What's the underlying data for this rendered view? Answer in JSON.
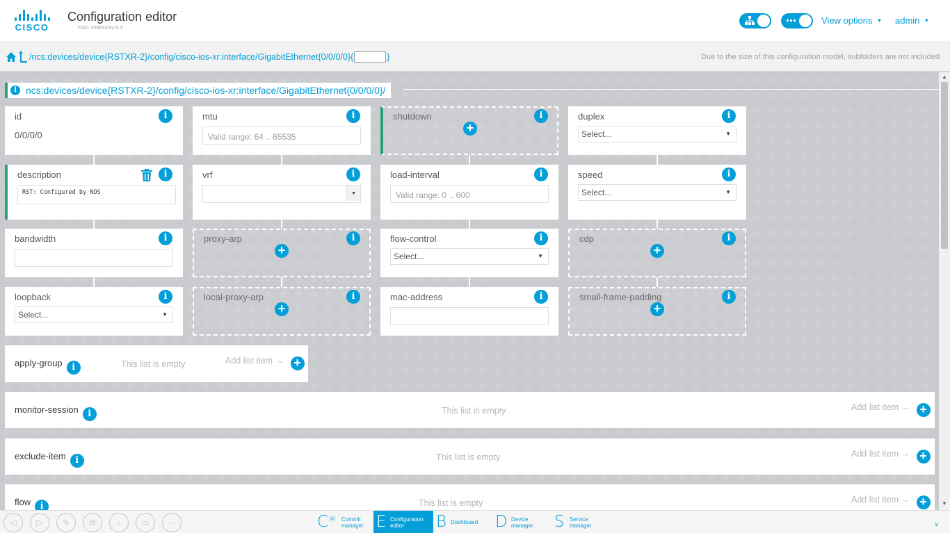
{
  "header": {
    "logo_text": "CISCO",
    "title": "Configuration editor",
    "version": "NSO VERSION:5.3",
    "view_options_label": "View options",
    "user_label": "admin"
  },
  "pathbar": {
    "path_prefix": "/ncs:devices/device{RSTXR-2}/config/cisco-ios-xr:interface/GigabitEthernet{0/0/0/0}{",
    "path_suffix": "}",
    "path_key_value": "",
    "note": "Due to the size of this configuration model, subfolders are not included"
  },
  "section": {
    "path": "ncs:devices/device{RSTXR-2}/config/cisco-ios-xr:interface/GigabitEthernet{0/0/0/0}/"
  },
  "fields": {
    "id": {
      "label": "id",
      "value": "0/0/0/0"
    },
    "mtu": {
      "label": "mtu",
      "placeholder": "Valid range: 64 .. 65535"
    },
    "shutdown": {
      "label": "shutdown"
    },
    "duplex": {
      "label": "duplex",
      "selected": "Select..."
    },
    "description": {
      "label": "description",
      "value": "RST: Configured by NOS"
    },
    "vrf": {
      "label": "vrf",
      "selected": ""
    },
    "load_interval": {
      "label": "load-interval",
      "placeholder": "Valid range: 0 .. 600"
    },
    "speed": {
      "label": "speed",
      "selected": "Select..."
    },
    "bandwidth": {
      "label": "bandwidth",
      "value": ""
    },
    "proxy_arp": {
      "label": "proxy-arp"
    },
    "flow_control": {
      "label": "flow-control",
      "selected": "Select..."
    },
    "cdp": {
      "label": "cdp"
    },
    "loopback": {
      "label": "loopback",
      "selected": "Select..."
    },
    "local_proxy_arp": {
      "label": "local-proxy-arp"
    },
    "mac_address": {
      "label": "mac-address",
      "value": ""
    },
    "small_frame_padding": {
      "label": "small-frame-padding"
    }
  },
  "lists": [
    {
      "name": "apply-group",
      "empty_text": "This list is empty",
      "add_label": "Add list item"
    },
    {
      "name": "monitor-session",
      "empty_text": "This list is empty",
      "add_label": "Add list item"
    },
    {
      "name": "exclude-item",
      "empty_text": "This list is empty",
      "add_label": "Add list item"
    },
    {
      "name": "flow",
      "empty_text": "This list is empty",
      "add_label": "Add list item"
    }
  ],
  "bottom_apps": [
    {
      "letter": "C*",
      "line1": "Commit",
      "line2": "manager",
      "active": false
    },
    {
      "letter": "E",
      "line1": "Configuration",
      "line2": "editor",
      "active": true
    },
    {
      "letter": "B",
      "line1": "Dashboard",
      "line2": "",
      "active": false
    },
    {
      "letter": "D",
      "line1": "Device",
      "line2": "manager",
      "active": false
    },
    {
      "letter": "S",
      "line1": "Service",
      "line2": "manager",
      "active": false
    }
  ],
  "tools": [
    "back-icon",
    "forward-icon",
    "edit-icon",
    "copy-icon",
    "search-icon",
    "terminal-icon",
    "more-icon"
  ],
  "colors": {
    "accent": "#049fd9",
    "green": "#2aa079",
    "background": "#c9cbce"
  }
}
